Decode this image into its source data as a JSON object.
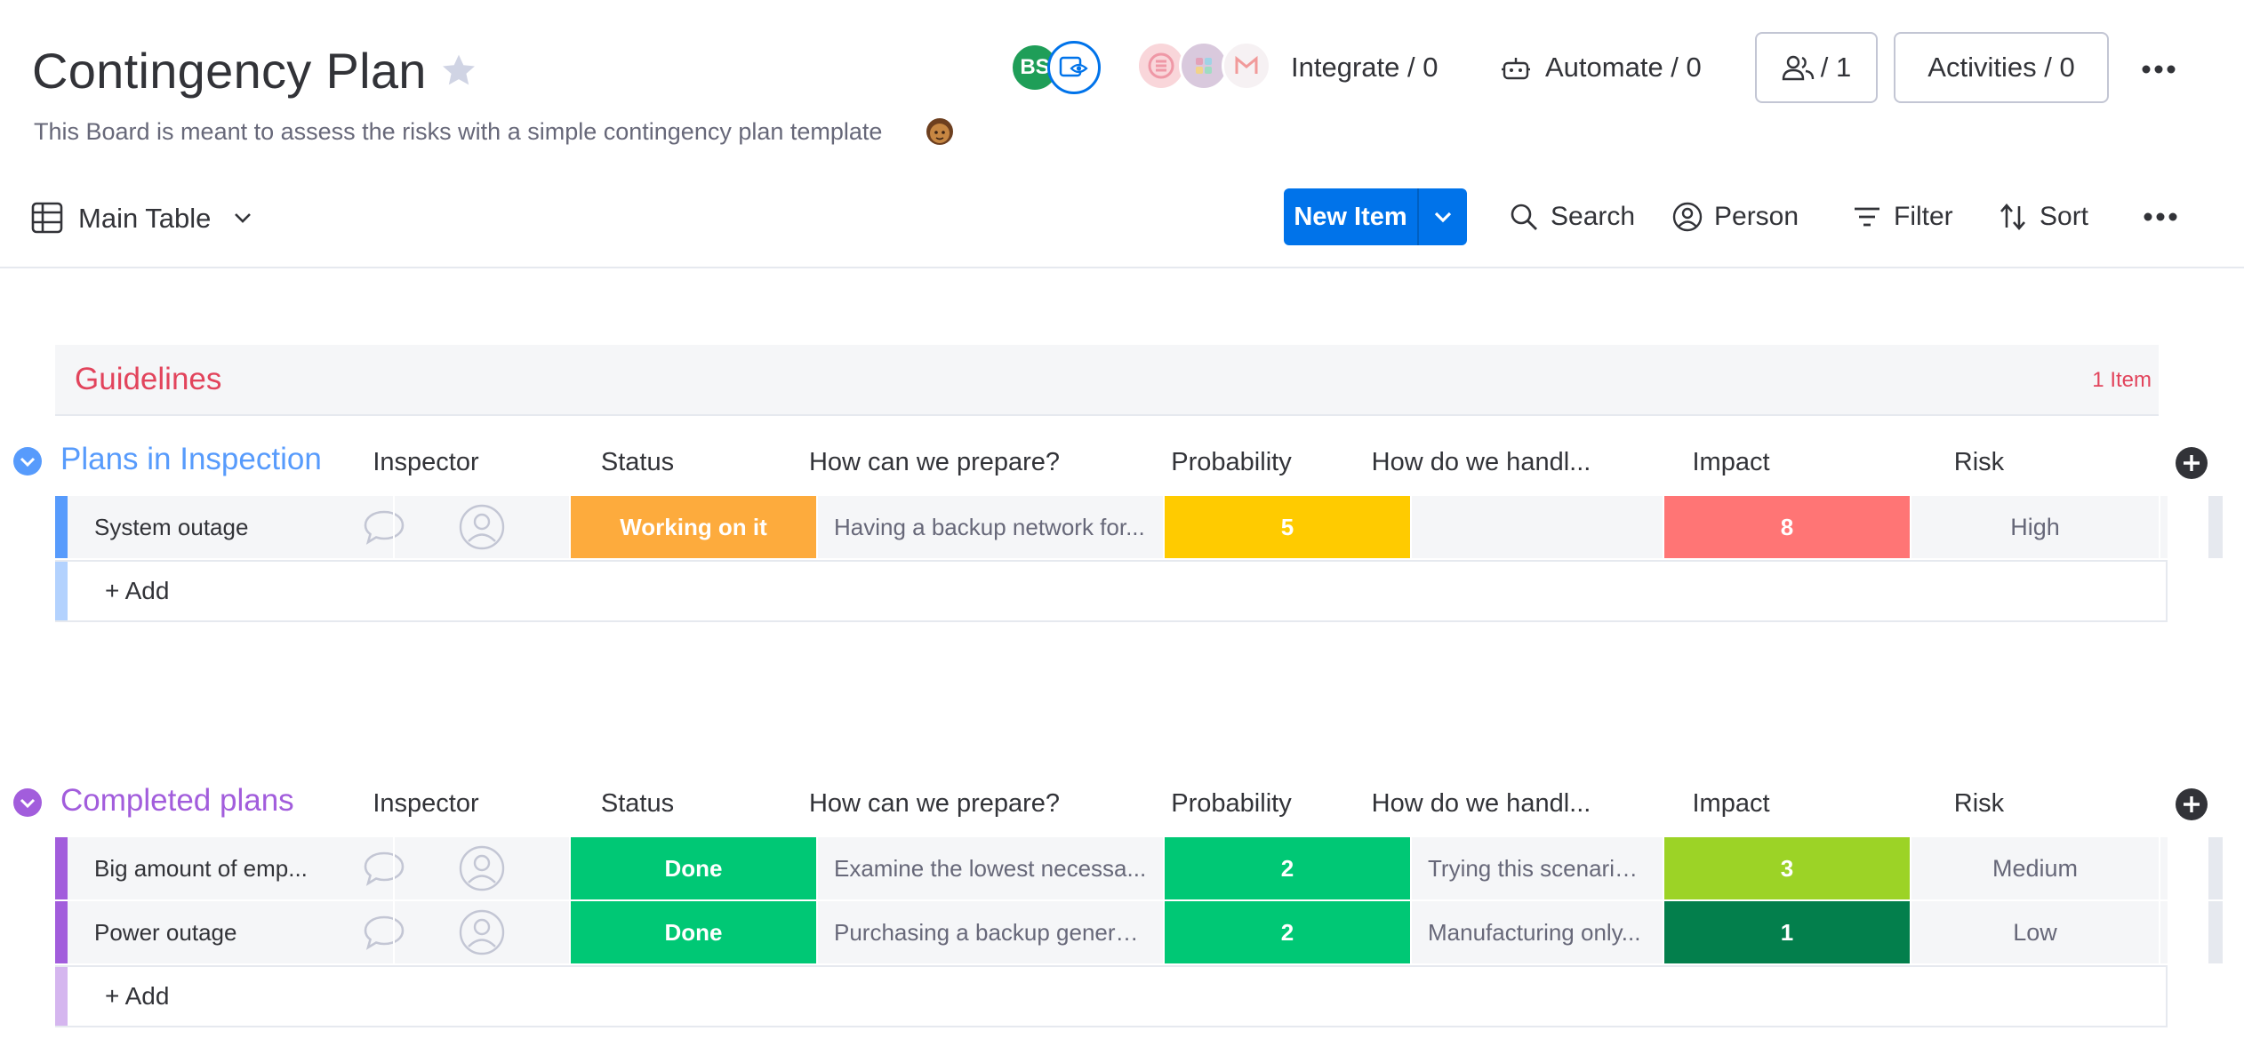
{
  "board": {
    "title": "Contingency Plan",
    "description": "This Board is meant to assess the risks with a simple contingency plan template",
    "avatar_initials": "BS"
  },
  "header": {
    "integrate_label": "Integrate / 0",
    "automate_label": "Automate / 0",
    "members_label": "/ 1",
    "activities_label": "Activities / 0"
  },
  "toolbar": {
    "view_label": "Main Table",
    "new_item_label": "New Item",
    "search_label": "Search",
    "person_label": "Person",
    "filter_label": "Filter",
    "sort_label": "Sort"
  },
  "guidelines": {
    "title": "Guidelines",
    "count": "1 Item"
  },
  "columns": {
    "inspector": "Inspector",
    "status": "Status",
    "prepare": "How can we prepare?",
    "probability": "Probability",
    "handle": "How do we handl...",
    "impact": "Impact",
    "risk": "Risk"
  },
  "groups": [
    {
      "title": "Plans in Inspection",
      "color": "#579bfc",
      "add_label": "+ Add",
      "items": [
        {
          "name": "System outage",
          "status": "Working on it",
          "status_color": "#fdab3d",
          "prepare": "Having a backup network for...",
          "probability": "5",
          "probability_color": "#ffcb00",
          "handle": "",
          "impact": "8",
          "impact_color": "#ff7575",
          "risk": "High"
        }
      ]
    },
    {
      "title": "Completed plans",
      "color": "#a25ddc",
      "add_label": "+ Add",
      "items": [
        {
          "name": "Big amount of emp...",
          "status": "Done",
          "status_color": "#00c875",
          "prepare": "Examine the lowest necessa...",
          "probability": "2",
          "probability_color": "#00c875",
          "handle": "Trying this scenario...",
          "impact": "3",
          "impact_color": "#9cd326",
          "risk": "Medium"
        },
        {
          "name": "Power outage",
          "status": "Done",
          "status_color": "#00c875",
          "prepare": "Purchasing a backup generat...",
          "probability": "2",
          "probability_color": "#00c875",
          "handle": "Manufacturing only...",
          "impact": "1",
          "impact_color": "#037f4c",
          "risk": "Low"
        }
      ]
    }
  ],
  "icons": [
    "star-icon",
    "emoji-icon",
    "eye-icon",
    "robot-icon",
    "person-icon",
    "more-icon",
    "table-icon",
    "chevron-down-icon",
    "search-icon",
    "filter-icon",
    "sort-icon",
    "comment-icon",
    "add-column-icon"
  ]
}
